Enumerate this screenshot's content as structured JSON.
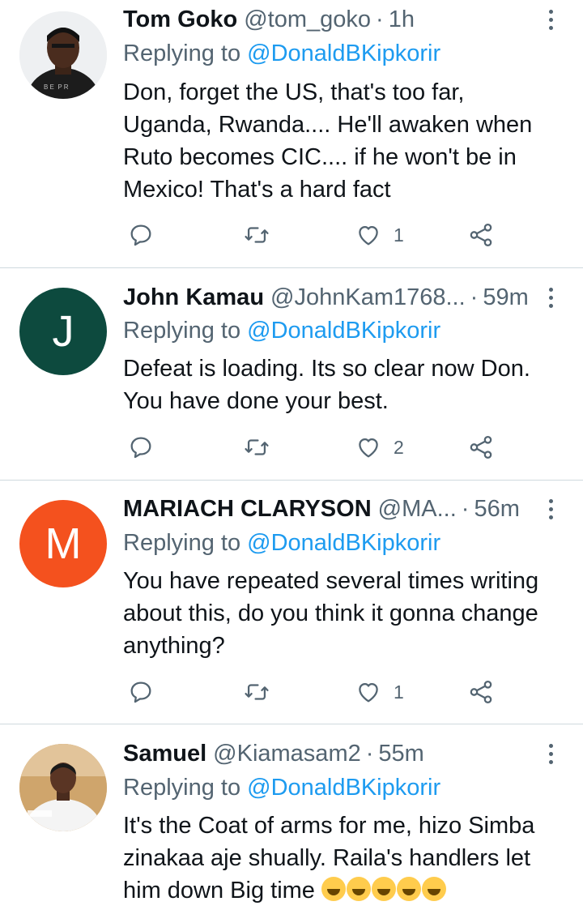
{
  "colors": {
    "link": "#1d9bf0",
    "secondary": "#536471",
    "divider": "#cfd9de"
  },
  "reply_prefix": "Replying to",
  "replies": [
    {
      "name": "Tom Goko",
      "handle": "@tom_goko",
      "separator": "·",
      "time": "1h",
      "mention": "@DonaldBKipkorir",
      "avatar": {
        "type": "photo"
      },
      "lines": [
        "Don, forget the US, that's too far,",
        "Uganda, Rwanda.... He'll awaken when",
        "Ruto becomes CIC.... if he won't be in",
        "Mexico! That's a hard fact"
      ],
      "likes": "1"
    },
    {
      "name": "John Kamau",
      "handle": "@JohnKam1768...",
      "separator": "·",
      "time": "59m",
      "mention": "@DonaldBKipkorir",
      "avatar": {
        "type": "letter",
        "letter": "J",
        "color": "#0d4a3e"
      },
      "lines": [
        "Defeat is loading. Its so clear now Don.",
        "You have done your best."
      ],
      "likes": "2"
    },
    {
      "name": "MARIACH CLARYSON",
      "handle": "@MA...",
      "separator": "·",
      "time": "56m",
      "mention": "@DonaldBKipkorir",
      "avatar": {
        "type": "letter",
        "letter": "M",
        "color": "#f4511e"
      },
      "lines": [
        "You have repeated several times writing",
        "about this, do you think it gonna change",
        "anything?"
      ],
      "likes": "1"
    },
    {
      "name": "Samuel",
      "handle": "@Kiamasam2",
      "separator": "·",
      "time": "55m",
      "mention": "@DonaldBKipkorir",
      "avatar": {
        "type": "photo"
      },
      "lines": [
        "It's the Coat of arms for me, hizo Simba",
        "zinakaa aje shually. Raila's handlers let",
        "him down Big time"
      ],
      "emoji": [
        "rolling-on-floor-laughing",
        "rolling-on-floor-laughing",
        "rolling-on-floor-laughing",
        "rolling-on-floor-laughing",
        "rolling-on-floor-laughing"
      ]
    }
  ]
}
